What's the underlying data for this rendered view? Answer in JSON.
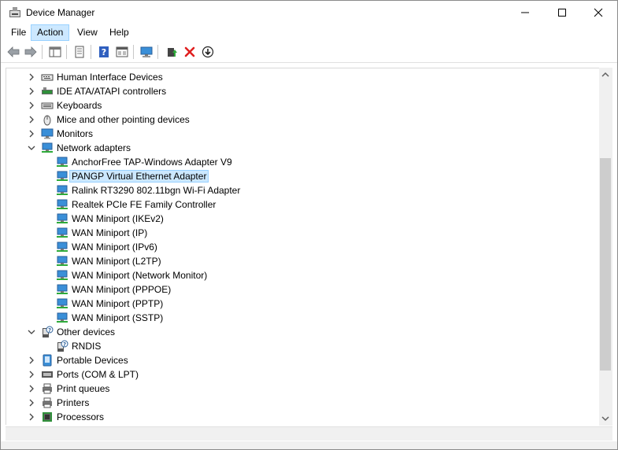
{
  "window": {
    "title": "Device Manager"
  },
  "menu": [
    "File",
    "Action",
    "View",
    "Help"
  ],
  "active_menu_index": 1,
  "toolbar": {
    "buttons": [
      "back-arrow-icon",
      "forward-arrow-icon",
      "show-hide-tree-icon",
      "properties-icon",
      "help-icon",
      "update-driver-icon",
      "scan-hardware-icon",
      "enable-device-icon",
      "uninstall-icon",
      "download-icon"
    ]
  },
  "tree": {
    "rows": [
      {
        "label": "Human Interface Devices",
        "level": 0,
        "expand": "collapsed",
        "icon": "hid-icon"
      },
      {
        "label": "IDE ATA/ATAPI controllers",
        "level": 0,
        "expand": "collapsed",
        "icon": "ide-icon"
      },
      {
        "label": "Keyboards",
        "level": 0,
        "expand": "collapsed",
        "icon": "keyboard-icon"
      },
      {
        "label": "Mice and other pointing devices",
        "level": 0,
        "expand": "collapsed",
        "icon": "mouse-icon"
      },
      {
        "label": "Monitors",
        "level": 0,
        "expand": "collapsed",
        "icon": "monitor-icon"
      },
      {
        "label": "Network adapters",
        "level": 0,
        "expand": "expanded",
        "icon": "network-icon"
      },
      {
        "label": "AnchorFree TAP-Windows Adapter V9",
        "level": 1,
        "expand": "none",
        "icon": "network-adapter-icon"
      },
      {
        "label": "PANGP Virtual Ethernet Adapter",
        "level": 1,
        "expand": "none",
        "icon": "network-adapter-icon",
        "selected": true
      },
      {
        "label": "Ralink RT3290 802.11bgn Wi-Fi Adapter",
        "level": 1,
        "expand": "none",
        "icon": "network-adapter-icon"
      },
      {
        "label": "Realtek PCIe FE Family Controller",
        "level": 1,
        "expand": "none",
        "icon": "network-adapter-icon"
      },
      {
        "label": "WAN Miniport (IKEv2)",
        "level": 1,
        "expand": "none",
        "icon": "network-adapter-icon"
      },
      {
        "label": "WAN Miniport (IP)",
        "level": 1,
        "expand": "none",
        "icon": "network-adapter-icon"
      },
      {
        "label": "WAN Miniport (IPv6)",
        "level": 1,
        "expand": "none",
        "icon": "network-adapter-icon"
      },
      {
        "label": "WAN Miniport (L2TP)",
        "level": 1,
        "expand": "none",
        "icon": "network-adapter-icon"
      },
      {
        "label": "WAN Miniport (Network Monitor)",
        "level": 1,
        "expand": "none",
        "icon": "network-adapter-icon"
      },
      {
        "label": "WAN Miniport (PPPOE)",
        "level": 1,
        "expand": "none",
        "icon": "network-adapter-icon"
      },
      {
        "label": "WAN Miniport (PPTP)",
        "level": 1,
        "expand": "none",
        "icon": "network-adapter-icon"
      },
      {
        "label": "WAN Miniport (SSTP)",
        "level": 1,
        "expand": "none",
        "icon": "network-adapter-icon"
      },
      {
        "label": "Other devices",
        "level": 0,
        "expand": "expanded",
        "icon": "unknown-device-icon"
      },
      {
        "label": "RNDIS",
        "level": 1,
        "expand": "none",
        "icon": "unknown-device-icon"
      },
      {
        "label": "Portable Devices",
        "level": 0,
        "expand": "collapsed",
        "icon": "portable-device-icon"
      },
      {
        "label": "Ports (COM & LPT)",
        "level": 0,
        "expand": "collapsed",
        "icon": "port-icon"
      },
      {
        "label": "Print queues",
        "level": 0,
        "expand": "collapsed",
        "icon": "print-queue-icon"
      },
      {
        "label": "Printers",
        "level": 0,
        "expand": "collapsed",
        "icon": "printer-icon"
      },
      {
        "label": "Processors",
        "level": 0,
        "expand": "collapsed",
        "icon": "processor-icon"
      }
    ]
  },
  "colors": {
    "selection_bg": "#cce8ff",
    "selection_border": "#99d1ff",
    "accent_blue": "#1e7fd8"
  }
}
